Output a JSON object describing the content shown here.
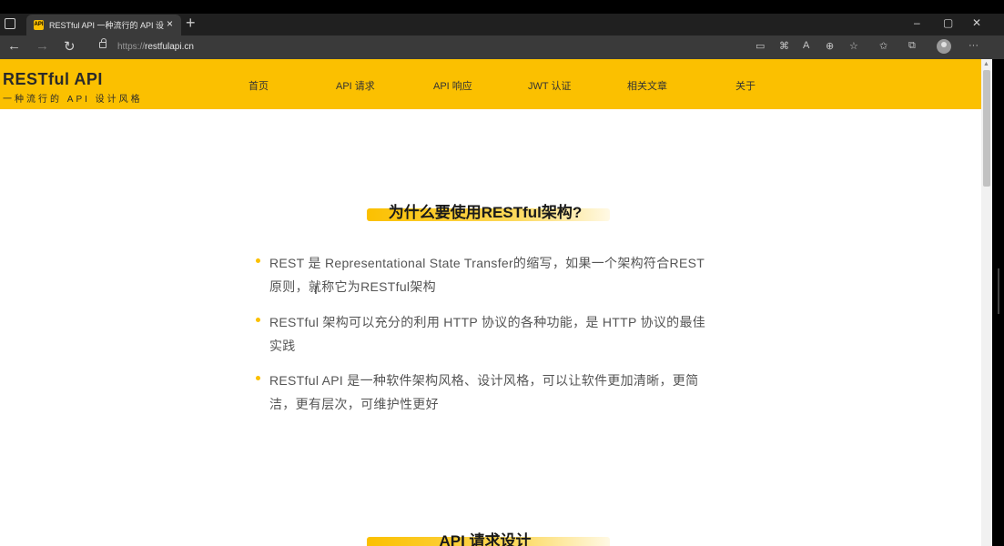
{
  "browser": {
    "tab_title": "RESTful API 一种流行的 API 设计",
    "favicon_text": "API",
    "tab_close": "×",
    "new_tab": "+",
    "url_prefix": "https://",
    "url_host": "restfulapi.cn",
    "window_controls": {
      "minimize": "–",
      "maximize": "▢",
      "close": "✕"
    }
  },
  "site": {
    "logo_title": "RESTful API",
    "logo_subtitle": "一种流行的 API 设计风格",
    "nav": [
      "首页",
      "API 请求",
      "API 响应",
      "JWT 认证",
      "相关文章",
      "关于"
    ],
    "accent_color": "#fbc000"
  },
  "main": {
    "section1_title": "为什么要使用RESTful架构?",
    "bullets": [
      "REST 是 Representational State Transfer的缩写，如果一个架构符合REST原则，就称它为RESTful架构",
      "RESTful 架构可以充分的利用 HTTP 协议的各种功能，是 HTTP 协议的最佳实践",
      "RESTful API 是一种软件架构风格、设计风格，可以让软件更加清晰，更简洁，更有层次，可维护性更好"
    ],
    "section2_title": "API 请求设计"
  }
}
